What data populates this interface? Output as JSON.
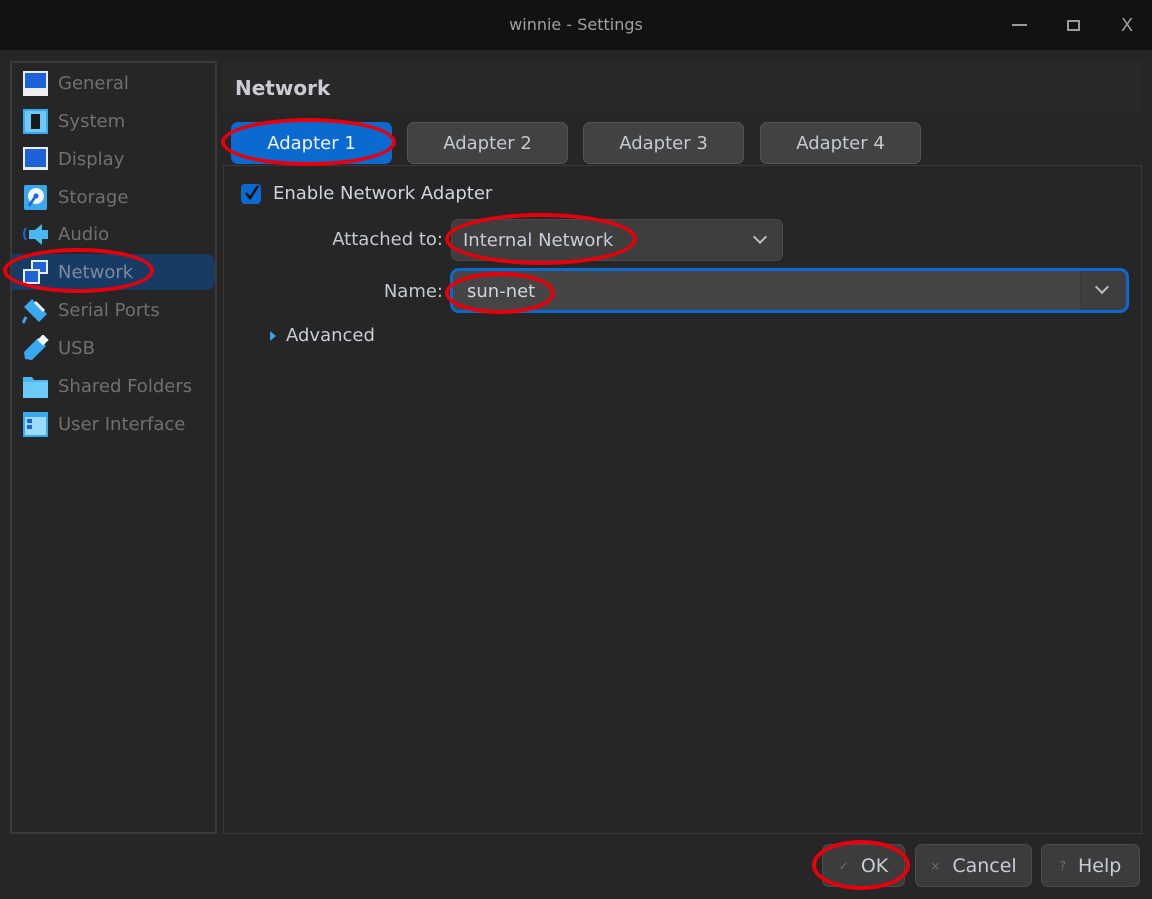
{
  "window": {
    "title": "winnie - Settings",
    "controls": [
      "minimize",
      "maximize",
      "close"
    ],
    "close_glyph": "X"
  },
  "sidebar": {
    "items": [
      {
        "label": "General",
        "icon": "monitor-icon"
      },
      {
        "label": "System",
        "icon": "chip-icon"
      },
      {
        "label": "Display",
        "icon": "display-icon"
      },
      {
        "label": "Storage",
        "icon": "disk-icon"
      },
      {
        "label": "Audio",
        "icon": "speaker-icon"
      },
      {
        "label": "Network",
        "icon": "network-icon",
        "selected": true
      },
      {
        "label": "Serial Ports",
        "icon": "serial-port-icon"
      },
      {
        "label": "USB",
        "icon": "usb-icon"
      },
      {
        "label": "Shared Folders",
        "icon": "folder-icon"
      },
      {
        "label": "User Interface",
        "icon": "user-interface-icon"
      }
    ]
  },
  "page": {
    "title": "Network",
    "tabs": [
      {
        "label": "Adapter 1",
        "selected": true
      },
      {
        "label": "Adapter 2"
      },
      {
        "label": "Adapter 3"
      },
      {
        "label": "Adapter 4"
      }
    ],
    "enable_adapter": {
      "label": "Enable Network Adapter",
      "checked": true
    },
    "attached_to": {
      "label": "Attached to:",
      "value": "Internal Network"
    },
    "name": {
      "label": "Name:",
      "value": "sun-net"
    },
    "advanced": {
      "label": "Advanced",
      "expanded": false
    }
  },
  "buttons": {
    "ok": {
      "label": "OK",
      "icon": "✓"
    },
    "cancel": {
      "label": "Cancel",
      "icon": "×"
    },
    "help": {
      "label": "Help",
      "icon": "?"
    }
  },
  "colors": {
    "accent": "#0a6ad0",
    "selection": "#173b62",
    "annotation": "#e8000c",
    "background": "#262626",
    "titlebar": "#121212"
  }
}
